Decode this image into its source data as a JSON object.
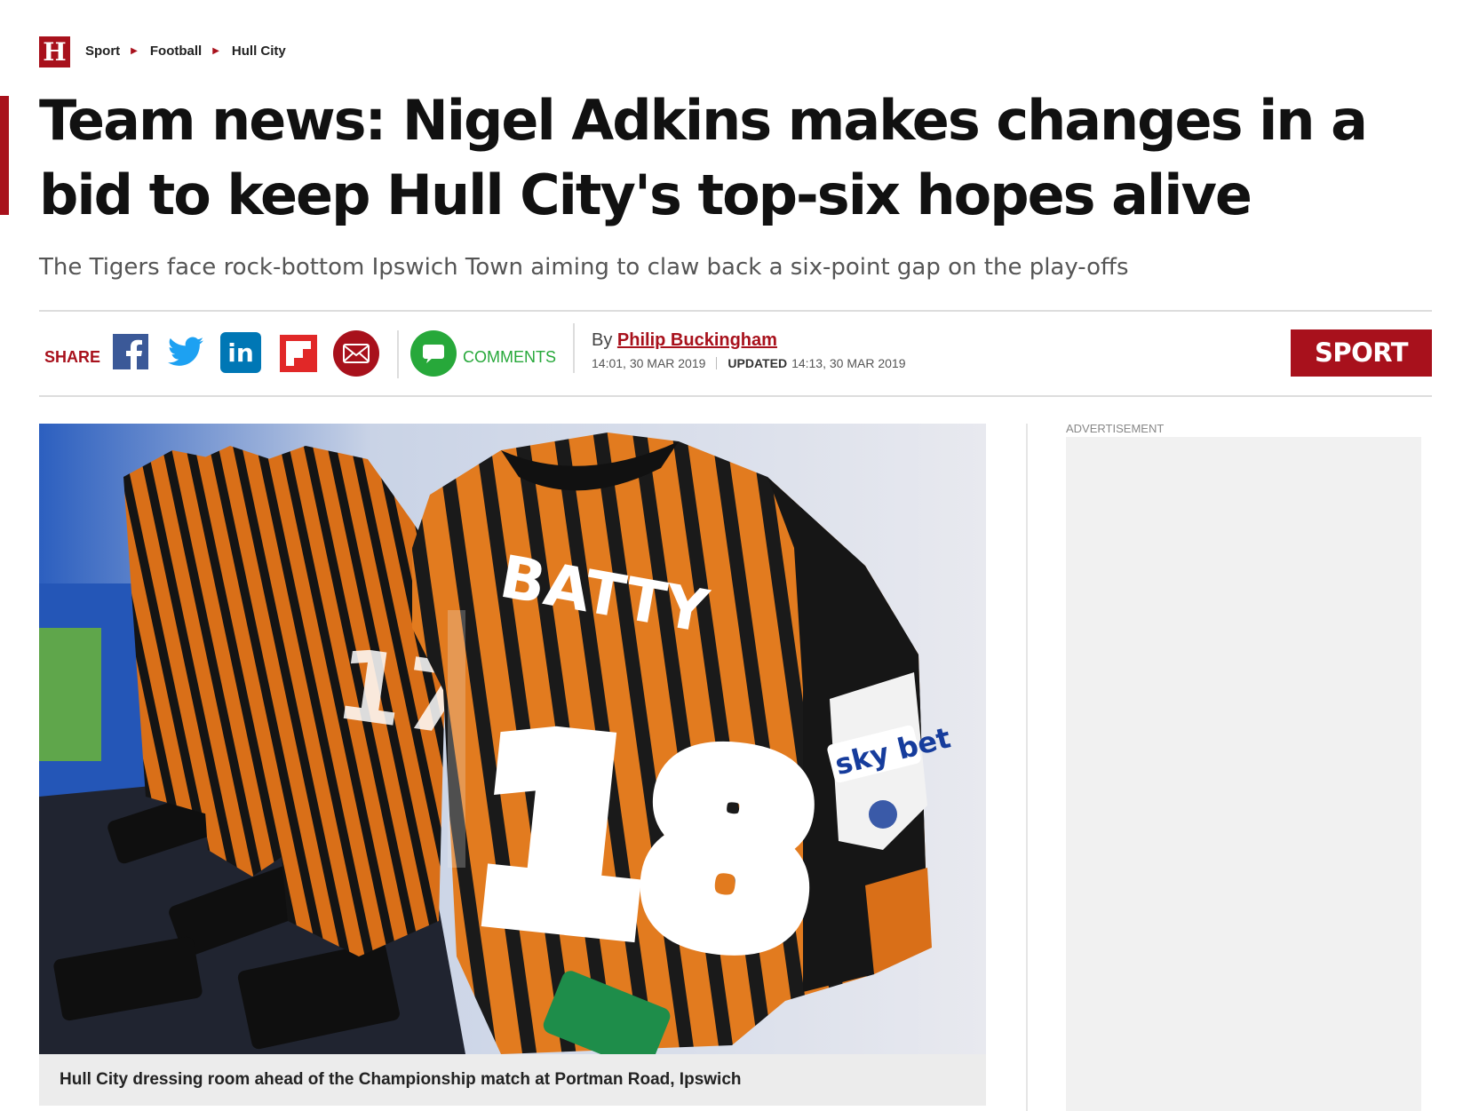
{
  "site": {
    "logo_letter": "H"
  },
  "breadcrumb": {
    "items": [
      "Sport",
      "Football",
      "Hull City"
    ]
  },
  "article": {
    "headline": "Team news: Nigel Adkins makes changes in a bid to keep Hull City's top-six hopes alive",
    "standfirst": "The Tigers face rock-bottom Ipswich Town aiming to claw back a six-point gap on the play-offs"
  },
  "share": {
    "label": "SHARE",
    "icons": [
      "facebook-icon",
      "twitter-icon",
      "linkedin-icon",
      "flipboard-icon",
      "email-icon"
    ],
    "colors": {
      "facebook": "#3b5998",
      "twitter": "#1da1f2",
      "linkedin": "#0077b5",
      "flipboard": "#e12828",
      "email": "#a8111c"
    }
  },
  "comments": {
    "label": "COMMENTS",
    "color": "#27a83a"
  },
  "byline": {
    "prefix": "By",
    "author": "Philip Buckingham",
    "published": "14:01, 30 MAR 2019",
    "updated_label": "UPDATED",
    "updated": "14:13, 30 MAR 2019"
  },
  "section_badge": {
    "label": "SPORT",
    "color": "#a8111c"
  },
  "hero": {
    "caption": "Hull City dressing room ahead of the Championship match at Portman Road, Ipswich",
    "shirt_name": "BATTY",
    "shirt_number": "18",
    "sleeve_badge": "sky bet"
  },
  "sidebar": {
    "ad_label": "ADVERTISEMENT"
  }
}
